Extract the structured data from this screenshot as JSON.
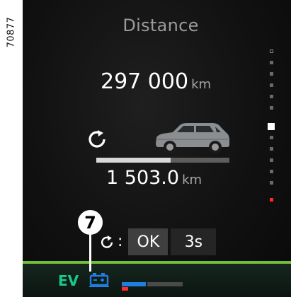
{
  "figure": {
    "reference": "70877"
  },
  "screen": {
    "title": "Distance"
  },
  "odometer": {
    "value": "297 000",
    "unit": "km"
  },
  "trip": {
    "value": "1 503.0",
    "unit": "km",
    "progress": 0.56
  },
  "reset": {
    "separator": ":",
    "confirm_label": "OK",
    "hold_label": "3s"
  },
  "status_bar": {
    "mode": "EV"
  },
  "callout": {
    "number": "7"
  },
  "icons": {
    "trip": "trip-reset-icon",
    "car": "car-icon",
    "reset": "trip-reset-icon",
    "battery": "battery-icon",
    "ev_gauge": "ev-charge-gauge-icon"
  },
  "colors": {
    "accent_green": "#6fbf3a",
    "ev_text": "#19c98a",
    "battery_blue": "#1e7fe0",
    "gauge_red": "#ff2a2a"
  }
}
